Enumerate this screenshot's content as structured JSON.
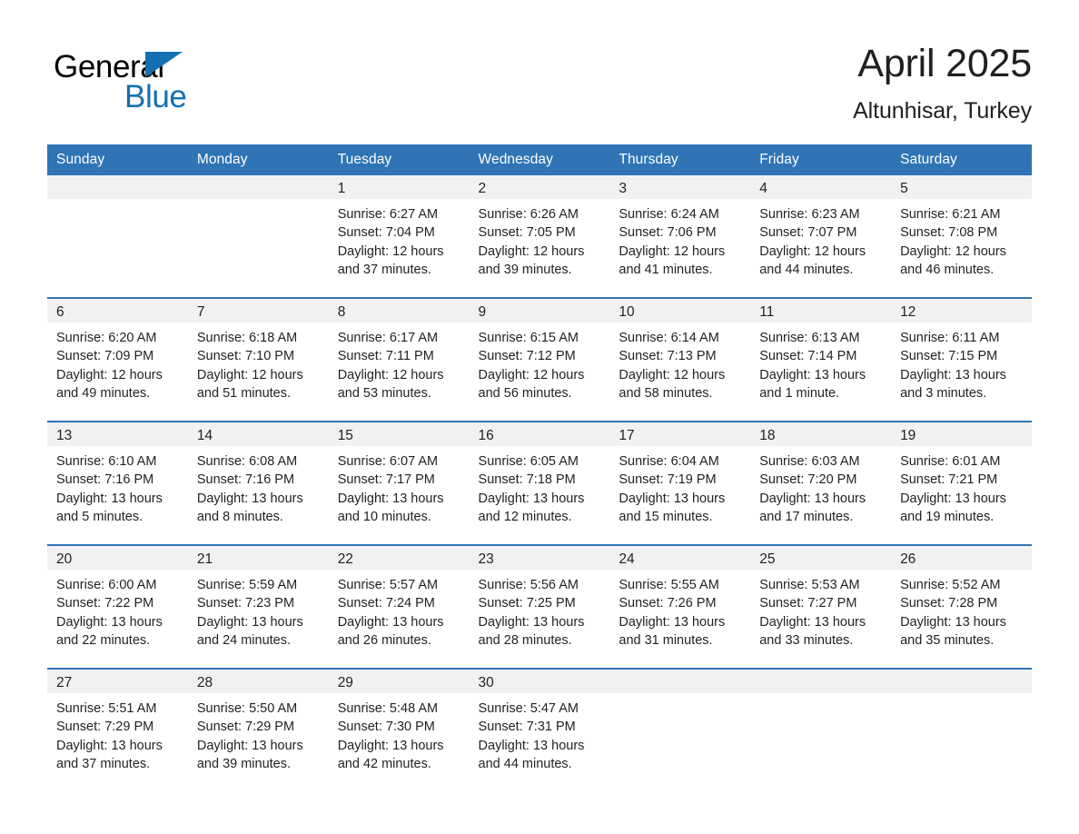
{
  "brand": {
    "name_part1": "General",
    "name_part2": "Blue",
    "logo_icon": "triangle-flag-icon",
    "color_blue": "#1470b0"
  },
  "header": {
    "month_title": "April 2025",
    "location": "Altunhisar, Turkey"
  },
  "theme": {
    "header_bar": "#2f74b5",
    "row_divider": "#2f74b5",
    "daynum_band": "#f1f1f1",
    "text": "#231f20"
  },
  "calendar": {
    "weekday_headers": [
      "Sunday",
      "Monday",
      "Tuesday",
      "Wednesday",
      "Thursday",
      "Friday",
      "Saturday"
    ],
    "weeks": [
      [
        {
          "day": "",
          "sunrise": "",
          "sunset": "",
          "daylight_line1": "",
          "daylight_line2": ""
        },
        {
          "day": "",
          "sunrise": "",
          "sunset": "",
          "daylight_line1": "",
          "daylight_line2": ""
        },
        {
          "day": "1",
          "sunrise": "Sunrise: 6:27 AM",
          "sunset": "Sunset: 7:04 PM",
          "daylight_line1": "Daylight: 12 hours",
          "daylight_line2": "and 37 minutes."
        },
        {
          "day": "2",
          "sunrise": "Sunrise: 6:26 AM",
          "sunset": "Sunset: 7:05 PM",
          "daylight_line1": "Daylight: 12 hours",
          "daylight_line2": "and 39 minutes."
        },
        {
          "day": "3",
          "sunrise": "Sunrise: 6:24 AM",
          "sunset": "Sunset: 7:06 PM",
          "daylight_line1": "Daylight: 12 hours",
          "daylight_line2": "and 41 minutes."
        },
        {
          "day": "4",
          "sunrise": "Sunrise: 6:23 AM",
          "sunset": "Sunset: 7:07 PM",
          "daylight_line1": "Daylight: 12 hours",
          "daylight_line2": "and 44 minutes."
        },
        {
          "day": "5",
          "sunrise": "Sunrise: 6:21 AM",
          "sunset": "Sunset: 7:08 PM",
          "daylight_line1": "Daylight: 12 hours",
          "daylight_line2": "and 46 minutes."
        }
      ],
      [
        {
          "day": "6",
          "sunrise": "Sunrise: 6:20 AM",
          "sunset": "Sunset: 7:09 PM",
          "daylight_line1": "Daylight: 12 hours",
          "daylight_line2": "and 49 minutes."
        },
        {
          "day": "7",
          "sunrise": "Sunrise: 6:18 AM",
          "sunset": "Sunset: 7:10 PM",
          "daylight_line1": "Daylight: 12 hours",
          "daylight_line2": "and 51 minutes."
        },
        {
          "day": "8",
          "sunrise": "Sunrise: 6:17 AM",
          "sunset": "Sunset: 7:11 PM",
          "daylight_line1": "Daylight: 12 hours",
          "daylight_line2": "and 53 minutes."
        },
        {
          "day": "9",
          "sunrise": "Sunrise: 6:15 AM",
          "sunset": "Sunset: 7:12 PM",
          "daylight_line1": "Daylight: 12 hours",
          "daylight_line2": "and 56 minutes."
        },
        {
          "day": "10",
          "sunrise": "Sunrise: 6:14 AM",
          "sunset": "Sunset: 7:13 PM",
          "daylight_line1": "Daylight: 12 hours",
          "daylight_line2": "and 58 minutes."
        },
        {
          "day": "11",
          "sunrise": "Sunrise: 6:13 AM",
          "sunset": "Sunset: 7:14 PM",
          "daylight_line1": "Daylight: 13 hours",
          "daylight_line2": "and 1 minute."
        },
        {
          "day": "12",
          "sunrise": "Sunrise: 6:11 AM",
          "sunset": "Sunset: 7:15 PM",
          "daylight_line1": "Daylight: 13 hours",
          "daylight_line2": "and 3 minutes."
        }
      ],
      [
        {
          "day": "13",
          "sunrise": "Sunrise: 6:10 AM",
          "sunset": "Sunset: 7:16 PM",
          "daylight_line1": "Daylight: 13 hours",
          "daylight_line2": "and 5 minutes."
        },
        {
          "day": "14",
          "sunrise": "Sunrise: 6:08 AM",
          "sunset": "Sunset: 7:16 PM",
          "daylight_line1": "Daylight: 13 hours",
          "daylight_line2": "and 8 minutes."
        },
        {
          "day": "15",
          "sunrise": "Sunrise: 6:07 AM",
          "sunset": "Sunset: 7:17 PM",
          "daylight_line1": "Daylight: 13 hours",
          "daylight_line2": "and 10 minutes."
        },
        {
          "day": "16",
          "sunrise": "Sunrise: 6:05 AM",
          "sunset": "Sunset: 7:18 PM",
          "daylight_line1": "Daylight: 13 hours",
          "daylight_line2": "and 12 minutes."
        },
        {
          "day": "17",
          "sunrise": "Sunrise: 6:04 AM",
          "sunset": "Sunset: 7:19 PM",
          "daylight_line1": "Daylight: 13 hours",
          "daylight_line2": "and 15 minutes."
        },
        {
          "day": "18",
          "sunrise": "Sunrise: 6:03 AM",
          "sunset": "Sunset: 7:20 PM",
          "daylight_line1": "Daylight: 13 hours",
          "daylight_line2": "and 17 minutes."
        },
        {
          "day": "19",
          "sunrise": "Sunrise: 6:01 AM",
          "sunset": "Sunset: 7:21 PM",
          "daylight_line1": "Daylight: 13 hours",
          "daylight_line2": "and 19 minutes."
        }
      ],
      [
        {
          "day": "20",
          "sunrise": "Sunrise: 6:00 AM",
          "sunset": "Sunset: 7:22 PM",
          "daylight_line1": "Daylight: 13 hours",
          "daylight_line2": "and 22 minutes."
        },
        {
          "day": "21",
          "sunrise": "Sunrise: 5:59 AM",
          "sunset": "Sunset: 7:23 PM",
          "daylight_line1": "Daylight: 13 hours",
          "daylight_line2": "and 24 minutes."
        },
        {
          "day": "22",
          "sunrise": "Sunrise: 5:57 AM",
          "sunset": "Sunset: 7:24 PM",
          "daylight_line1": "Daylight: 13 hours",
          "daylight_line2": "and 26 minutes."
        },
        {
          "day": "23",
          "sunrise": "Sunrise: 5:56 AM",
          "sunset": "Sunset: 7:25 PM",
          "daylight_line1": "Daylight: 13 hours",
          "daylight_line2": "and 28 minutes."
        },
        {
          "day": "24",
          "sunrise": "Sunrise: 5:55 AM",
          "sunset": "Sunset: 7:26 PM",
          "daylight_line1": "Daylight: 13 hours",
          "daylight_line2": "and 31 minutes."
        },
        {
          "day": "25",
          "sunrise": "Sunrise: 5:53 AM",
          "sunset": "Sunset: 7:27 PM",
          "daylight_line1": "Daylight: 13 hours",
          "daylight_line2": "and 33 minutes."
        },
        {
          "day": "26",
          "sunrise": "Sunrise: 5:52 AM",
          "sunset": "Sunset: 7:28 PM",
          "daylight_line1": "Daylight: 13 hours",
          "daylight_line2": "and 35 minutes."
        }
      ],
      [
        {
          "day": "27",
          "sunrise": "Sunrise: 5:51 AM",
          "sunset": "Sunset: 7:29 PM",
          "daylight_line1": "Daylight: 13 hours",
          "daylight_line2": "and 37 minutes."
        },
        {
          "day": "28",
          "sunrise": "Sunrise: 5:50 AM",
          "sunset": "Sunset: 7:29 PM",
          "daylight_line1": "Daylight: 13 hours",
          "daylight_line2": "and 39 minutes."
        },
        {
          "day": "29",
          "sunrise": "Sunrise: 5:48 AM",
          "sunset": "Sunset: 7:30 PM",
          "daylight_line1": "Daylight: 13 hours",
          "daylight_line2": "and 42 minutes."
        },
        {
          "day": "30",
          "sunrise": "Sunrise: 5:47 AM",
          "sunset": "Sunset: 7:31 PM",
          "daylight_line1": "Daylight: 13 hours",
          "daylight_line2": "and 44 minutes."
        },
        {
          "day": "",
          "sunrise": "",
          "sunset": "",
          "daylight_line1": "",
          "daylight_line2": ""
        },
        {
          "day": "",
          "sunrise": "",
          "sunset": "",
          "daylight_line1": "",
          "daylight_line2": ""
        },
        {
          "day": "",
          "sunrise": "",
          "sunset": "",
          "daylight_line1": "",
          "daylight_line2": ""
        }
      ]
    ]
  }
}
